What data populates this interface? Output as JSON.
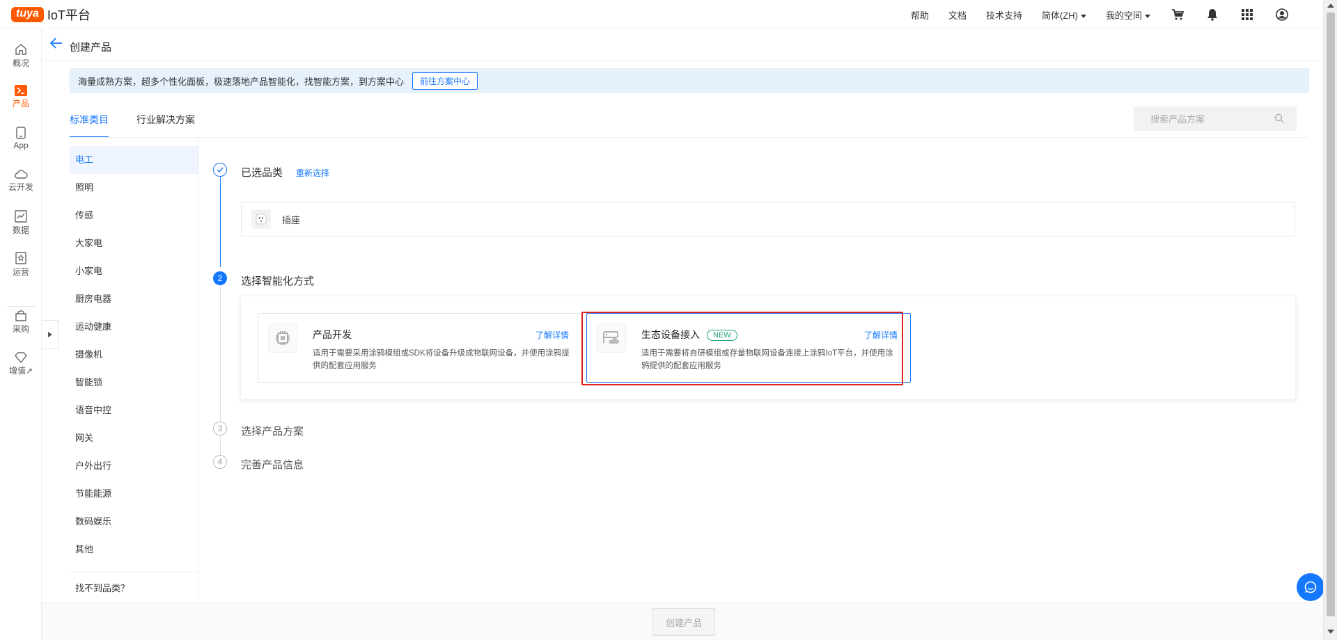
{
  "topbar": {
    "logo_badge": "tuya",
    "logo_text": "IoT平台",
    "nav": {
      "help": "帮助",
      "docs": "文档",
      "support": "技术支持",
      "language": "简体(ZH)",
      "my_space": "我的空间"
    },
    "icons": [
      "cart-icon",
      "bell-icon",
      "apps-grid-icon",
      "user-avatar-icon"
    ]
  },
  "sidebar": {
    "items": [
      {
        "label": "概况",
        "icon": "home-icon"
      },
      {
        "label": "产品",
        "icon": "terminal-icon",
        "active": true
      },
      {
        "label": "App",
        "icon": "phone-icon"
      },
      {
        "label": "云开发",
        "icon": "cloud-icon"
      },
      {
        "label": "数据",
        "icon": "chart-icon"
      },
      {
        "label": "运营",
        "icon": "badge-icon"
      },
      {
        "label": "采购",
        "icon": "shop-icon"
      },
      {
        "label": "增值↗",
        "icon": "diamond-icon"
      }
    ]
  },
  "header": {
    "title": "创建产品"
  },
  "banner": {
    "text": "海量成熟方案，超多个性化面板，极速落地产品智能化，找智能方案，到方案中心",
    "button": "前往方案中心"
  },
  "tabs": [
    {
      "label": "标准类目",
      "active": true
    },
    {
      "label": "行业解决方案",
      "active": false
    }
  ],
  "search": {
    "placeholder": "搜索产品方案"
  },
  "categories": [
    "电工",
    "照明",
    "传感",
    "大家电",
    "小家电",
    "厨房电器",
    "运动健康",
    "摄像机",
    "智能锁",
    "语音中控",
    "网关",
    "户外出行",
    "节能能源",
    "数码娱乐",
    "其他"
  ],
  "categories_footer": "找不到品类？",
  "steps": {
    "step1": {
      "title": "已选品类",
      "action": "重新选择",
      "selected": "插座"
    },
    "step2": {
      "number": "2",
      "title": "选择智能化方式"
    },
    "step3": {
      "number": "3",
      "title": "选择产品方案"
    },
    "step4": {
      "number": "4",
      "title": "完善产品信息"
    }
  },
  "methods": [
    {
      "title": "产品开发",
      "link": "了解详情",
      "desc": "适用于需要采用涂鸦模组或SDK将设备升级成物联网设备，并使用涂鸦提供的配套应用服务"
    },
    {
      "title": "生态设备接入",
      "badge": "NEW",
      "link": "了解详情",
      "desc": "适用于需要将自研模组或存量物联网设备连接上涂鸦IoT平台，并使用涂鸦提供的配套应用服务"
    }
  ],
  "footer": {
    "create_button": "创建产品"
  }
}
